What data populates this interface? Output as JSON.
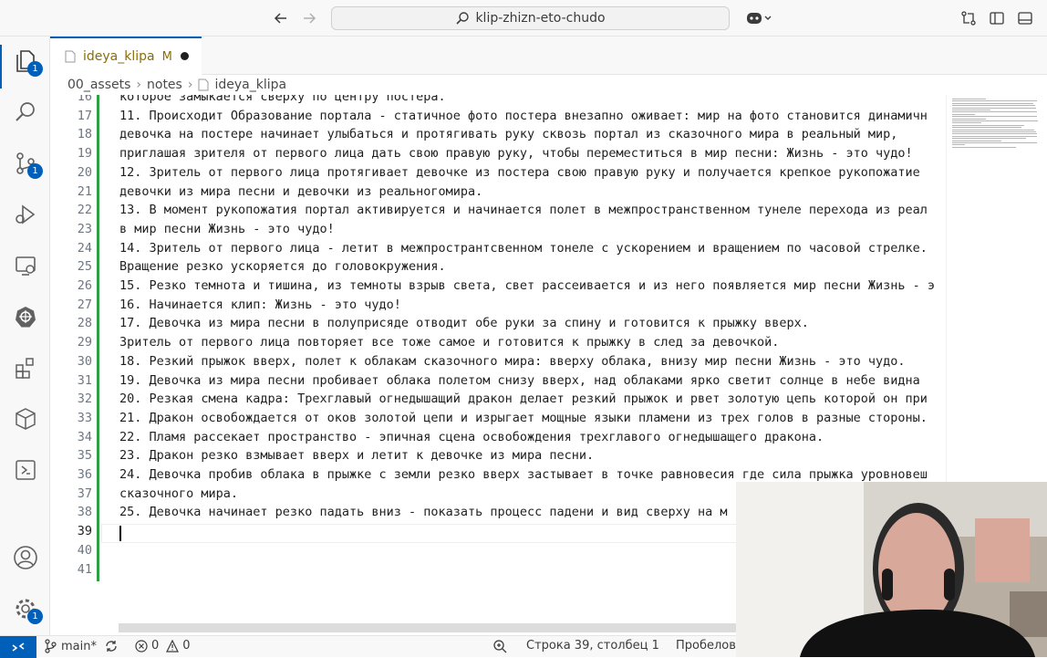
{
  "titlebar": {
    "search_text": "klip-zhizn-eto-chudo"
  },
  "activity_bar": {
    "explorer_badge": "1",
    "scm_badge": "1",
    "settings_badge": "1"
  },
  "tab": {
    "label": "ideya_klipa",
    "modified_marker": "M"
  },
  "breadcrumb": {
    "items": [
      "00_assets",
      "notes",
      "ideya_klipa"
    ]
  },
  "editor": {
    "lines": [
      {
        "n": "16",
        "t": "которое замыкается сверху по центру постера."
      },
      {
        "n": "17",
        "t": "11. Происходит Образование портала - статичное фото постера внезапно оживает: мир на фото становится динамичн"
      },
      {
        "n": "18",
        "t": "девочка на постере начинает улыбаться и протягивать руку сквозь портал из сказочного мира в реальный мир,"
      },
      {
        "n": "19",
        "t": "приглашая зрителя от первого лица дать свою правую руку, чтобы переместиться в мир песни: Жизнь - это чудо!"
      },
      {
        "n": "20",
        "t": "12. Зритель от первого лица протягивает девочке из постера свою правую руку и получается крепкое рукопожатие"
      },
      {
        "n": "21",
        "t": "девочки из мира песни и девочки из реальногомира."
      },
      {
        "n": "22",
        "t": "13. В момент рукопожатия портал активируется и начинается полет в межпространственном тунеле перехода из реал"
      },
      {
        "n": "23",
        "t": "в мир песни Жизнь - это чудо!"
      },
      {
        "n": "24",
        "t": "14. Зритель от первого лица - летит в межпространтсвенном тонеле с ускорением и вращением по часовой стрелке."
      },
      {
        "n": "25",
        "t": "Вращение резко ускоряется до головокружения."
      },
      {
        "n": "26",
        "t": "15. Резко темнота и тишина, из темноты взрыв света, свет рассеивается и из него появляется мир песни Жизнь - э"
      },
      {
        "n": "27",
        "t": "16. Начинается клип: Жизнь - это чудо!"
      },
      {
        "n": "28",
        "t": "17. Девочка из мира песни в полуприсяде отводит обе руки за спину и готовится к прыжку вверх."
      },
      {
        "n": "29",
        "t": "Зритель от первого лица повторяет все тоже самое и готовится к прыжку в след за девочкой."
      },
      {
        "n": "30",
        "t": "18. Резкий прыжок вверх, полет к облакам сказочного мира: вверху облака, внизу мир песни Жизнь - это чудо."
      },
      {
        "n": "31",
        "t": "19. Девочка из мира песни пробивает облака полетом снизу вверх, над облаками ярко светит солнце в небе видна"
      },
      {
        "n": "32",
        "t": "20. Резкая смена кадра: Трехглавый огнедышащий дракон делает резкий прыжок и рвет золотую цепь которой он при"
      },
      {
        "n": "33",
        "t": "21. Дракон освобождается от оков золотой цепи и изрыгает мощные языки пламени из трех голов в разные стороны."
      },
      {
        "n": "34",
        "t": "22. Пламя рассекает пространство - эпичная сцена освобождения трехглавого огнедышащего дракона."
      },
      {
        "n": "35",
        "t": "23. Дракон резко взмывает вверх и летит к девочке из мира песни."
      },
      {
        "n": "36",
        "t": "24. Девочка пробив облака в прыжке с земли резко вверх застывает в точке равновесия где сила прыжка уровновеш"
      },
      {
        "n": "37",
        "t": "сказочного мира."
      },
      {
        "n": "38",
        "t": "25. Девочка начинает резко падать вниз - показать процесс падени и вид сверху на м"
      },
      {
        "n": "39",
        "t": ""
      },
      {
        "n": "40",
        "t": ""
      },
      {
        "n": "41",
        "t": ""
      }
    ]
  },
  "statusbar": {
    "branch": "main*",
    "errors": "0",
    "warnings": "0",
    "position": "Строка 39, столбец 1",
    "indent": "Пробелов"
  },
  "colors": {
    "accent": "#005fb8",
    "modified_text": "#8a6d0b",
    "git_added": "#2ea043"
  }
}
